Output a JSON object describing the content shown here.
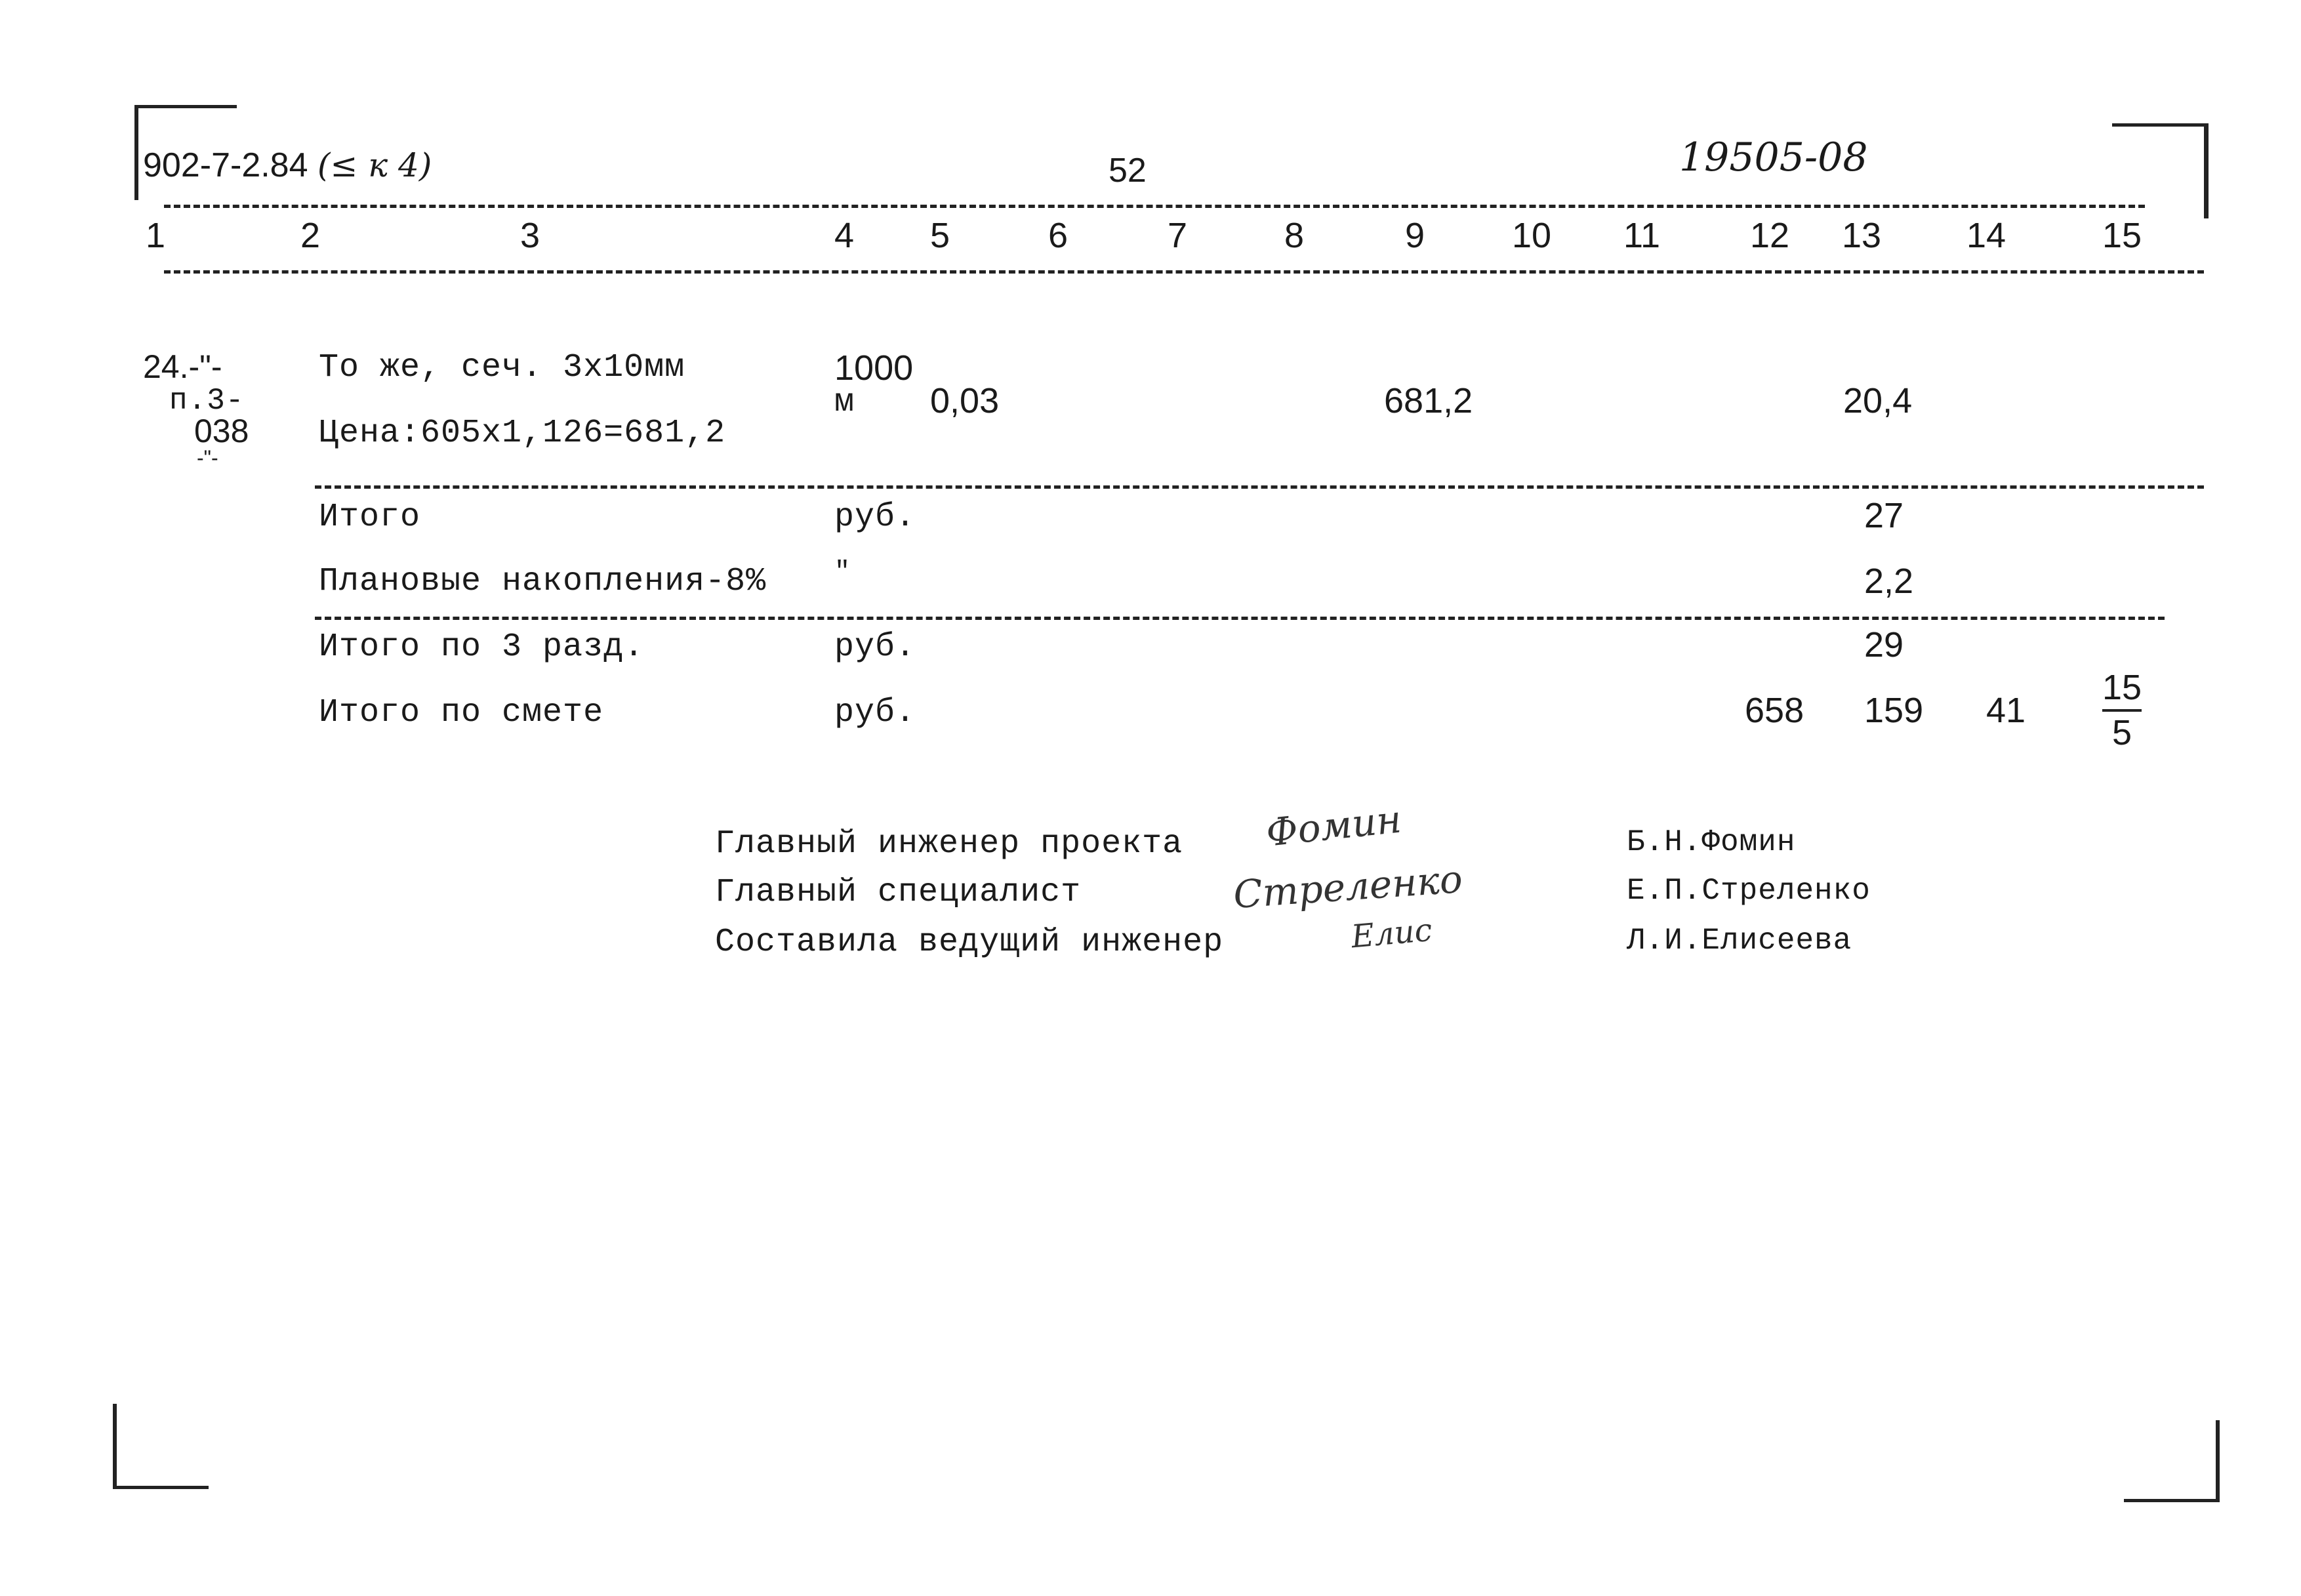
{
  "header": {
    "doc_code": "902-7-2.84",
    "doc_part": "(≤ к 4)",
    "page_number": "52",
    "inventory_number": "19505-08"
  },
  "column_numbers": [
    "1",
    "2",
    "3",
    "4",
    "5",
    "6",
    "7",
    "8",
    "9",
    "10",
    "11",
    "12",
    "13",
    "14",
    "15"
  ],
  "items": [
    {
      "num": "24.-\"-",
      "ref_line2": "п.3-",
      "ref_line3": "038",
      "ref_line4": "-\"-",
      "desc_line1": "То же, сеч. 3х10мм",
      "desc_line2": "Цена:605х1,126=681,2",
      "unit_line1": "1000",
      "unit_line2": "м",
      "col5": "0,03",
      "col9": "681,2",
      "col13": "20,4"
    }
  ],
  "totals": [
    {
      "label": "Итого",
      "unit": "руб.",
      "col13": "27"
    },
    {
      "label": "Плановые накопления-8%",
      "unit": "\"",
      "col13": "2,2"
    },
    {
      "label": "Итого по 3 разд.",
      "unit": "руб.",
      "col13": "29"
    },
    {
      "label": "Итого по смете",
      "unit": "руб.",
      "col12": "658",
      "col13": "159",
      "col14": "41",
      "col15_top": "15",
      "col15_bottom": "5"
    }
  ],
  "signatures": [
    {
      "role": "Главный инженер проекта",
      "signature": "Фомин",
      "name": "Б.Н.Фомин"
    },
    {
      "role": "Главный специалист",
      "signature": "Стреленко",
      "name": "Е.П.Стреленко"
    },
    {
      "role": "Составила ведущий инженер",
      "signature": "Елис",
      "name": "Л.И.Елисеева"
    }
  ]
}
